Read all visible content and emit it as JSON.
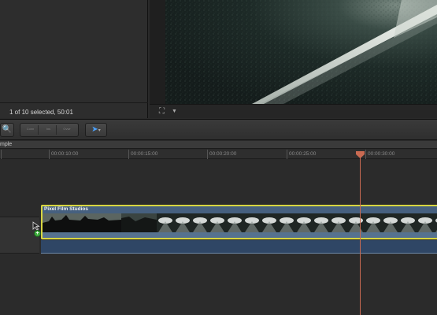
{
  "browser": {
    "status": "1 of 10 selected, 50:01"
  },
  "viewer": {
    "toolbar_icons": [
      "crop-icon",
      "dropdown-arrow-icon"
    ]
  },
  "toolbar": {
    "tools": [
      "key-icon",
      "connect-icon",
      "insert-icon",
      "append-icon",
      "overwrite-icon",
      "select-tool-arrow-icon"
    ],
    "seg_labels": [
      "Conn",
      "Ins",
      "Ovwr"
    ]
  },
  "project": {
    "name": "mple"
  },
  "ruler": {
    "ticks": [
      "00:00:10:00",
      "00:00:15:00",
      "00:00:20:00",
      "00:00:25:00",
      "00:00:30:00"
    ]
  },
  "timeline": {
    "clip_title": "Pixel Film Studios",
    "connect_badge": "+"
  },
  "colors": {
    "clip_border": "#d8d640",
    "clip_audio": "#56728f",
    "playhead": "#c96a52",
    "connect": "#3fae3f"
  }
}
